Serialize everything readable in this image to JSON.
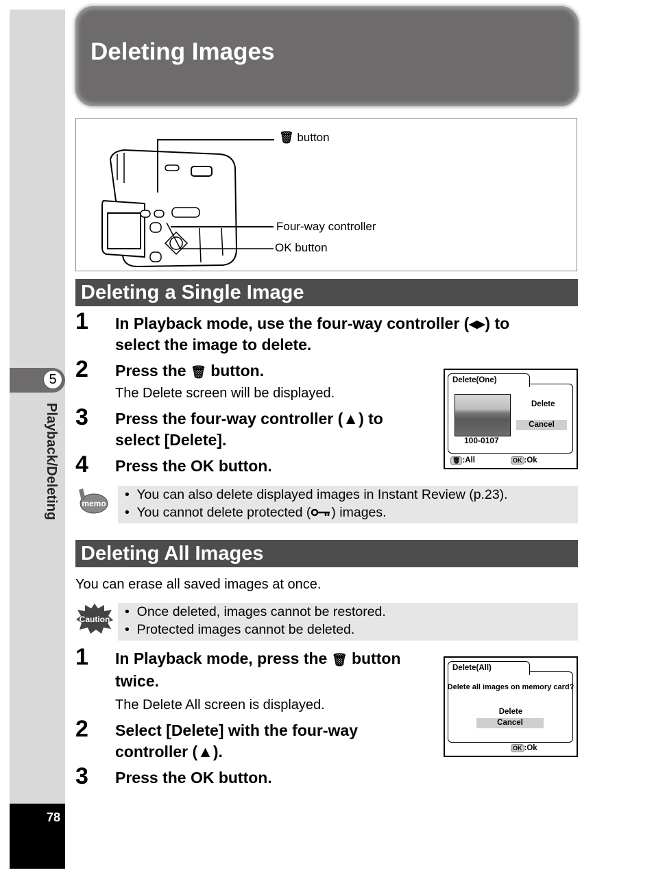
{
  "page": {
    "title": "Deleting Images",
    "number": "78",
    "chapter": {
      "number": "5",
      "label": "Playback/Deleting"
    }
  },
  "figure": {
    "icons": [
      "camera-illustration",
      "trash-icon"
    ],
    "callouts": {
      "trash_button": "button",
      "four_way": "Four-way controller",
      "ok_button": "OK button"
    }
  },
  "single": {
    "header": "Deleting a Single Image",
    "steps": [
      {
        "num": "1",
        "text_a": "In Playback mode, use the four-way controller (◂▸) to",
        "text_b": "select the image to delete."
      },
      {
        "num": "2",
        "text_pre": "Press the ",
        "text_post": " button.",
        "sub": "The Delete screen will be displayed."
      },
      {
        "num": "3",
        "text_a": "Press the four-way controller (▲) to",
        "text_b": "select [Delete]."
      },
      {
        "num": "4",
        "text_a": "Press the OK button."
      }
    ],
    "memo": {
      "icon": "memo-icon",
      "lines": [
        "You can also delete displayed images in Instant Review (p.23).",
        "You cannot delete protected (",
        ") images."
      ]
    },
    "screen": {
      "tab": "Delete(One)",
      "option_delete": "Delete",
      "option_cancel": "Cancel",
      "file_number": "100-0107",
      "footer_left": ":All",
      "footer_ok": "OK",
      "footer_right": ":Ok",
      "selected": "Cancel"
    }
  },
  "all": {
    "header": "Deleting All Images",
    "intro": "You can erase all saved images at once.",
    "caution": {
      "icon": "caution-icon",
      "icon_label": "Caution",
      "lines": [
        "Once deleted, images cannot be restored.",
        "Protected images cannot be deleted."
      ]
    },
    "steps": [
      {
        "num": "1",
        "text_pre": "In Playback mode, press the ",
        "text_post": " button",
        "text_b": "twice.",
        "sub": "The Delete All screen is displayed."
      },
      {
        "num": "2",
        "text_a": "Select [Delete] with the four-way",
        "text_b": "controller (▲)."
      },
      {
        "num": "3",
        "text_a": "Press the OK button."
      }
    ],
    "screen": {
      "tab": "Delete(All)",
      "question": "Delete all images on memory card?",
      "option_delete": "Delete",
      "option_cancel": "Cancel",
      "footer_ok": "OK",
      "footer_right": ":Ok",
      "selected": "Cancel"
    }
  },
  "memo_icon_label": "memo",
  "bullet": "•"
}
